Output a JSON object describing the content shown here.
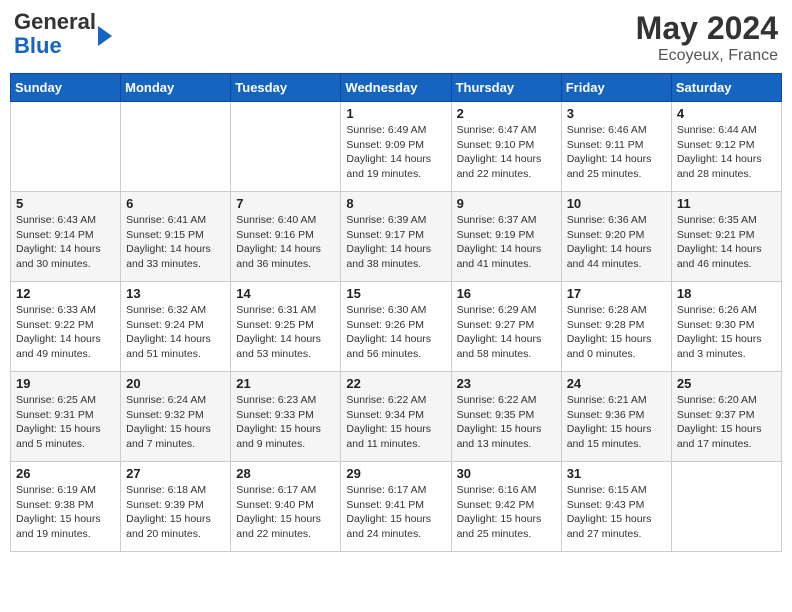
{
  "header": {
    "logo_line1": "General",
    "logo_line2": "Blue",
    "month": "May 2024",
    "location": "Ecoyeux, France"
  },
  "days_of_week": [
    "Sunday",
    "Monday",
    "Tuesday",
    "Wednesday",
    "Thursday",
    "Friday",
    "Saturday"
  ],
  "weeks": [
    [
      {
        "day": "",
        "info": ""
      },
      {
        "day": "",
        "info": ""
      },
      {
        "day": "",
        "info": ""
      },
      {
        "day": "1",
        "info": "Sunrise: 6:49 AM\nSunset: 9:09 PM\nDaylight: 14 hours\nand 19 minutes."
      },
      {
        "day": "2",
        "info": "Sunrise: 6:47 AM\nSunset: 9:10 PM\nDaylight: 14 hours\nand 22 minutes."
      },
      {
        "day": "3",
        "info": "Sunrise: 6:46 AM\nSunset: 9:11 PM\nDaylight: 14 hours\nand 25 minutes."
      },
      {
        "day": "4",
        "info": "Sunrise: 6:44 AM\nSunset: 9:12 PM\nDaylight: 14 hours\nand 28 minutes."
      }
    ],
    [
      {
        "day": "5",
        "info": "Sunrise: 6:43 AM\nSunset: 9:14 PM\nDaylight: 14 hours\nand 30 minutes."
      },
      {
        "day": "6",
        "info": "Sunrise: 6:41 AM\nSunset: 9:15 PM\nDaylight: 14 hours\nand 33 minutes."
      },
      {
        "day": "7",
        "info": "Sunrise: 6:40 AM\nSunset: 9:16 PM\nDaylight: 14 hours\nand 36 minutes."
      },
      {
        "day": "8",
        "info": "Sunrise: 6:39 AM\nSunset: 9:17 PM\nDaylight: 14 hours\nand 38 minutes."
      },
      {
        "day": "9",
        "info": "Sunrise: 6:37 AM\nSunset: 9:19 PM\nDaylight: 14 hours\nand 41 minutes."
      },
      {
        "day": "10",
        "info": "Sunrise: 6:36 AM\nSunset: 9:20 PM\nDaylight: 14 hours\nand 44 minutes."
      },
      {
        "day": "11",
        "info": "Sunrise: 6:35 AM\nSunset: 9:21 PM\nDaylight: 14 hours\nand 46 minutes."
      }
    ],
    [
      {
        "day": "12",
        "info": "Sunrise: 6:33 AM\nSunset: 9:22 PM\nDaylight: 14 hours\nand 49 minutes."
      },
      {
        "day": "13",
        "info": "Sunrise: 6:32 AM\nSunset: 9:24 PM\nDaylight: 14 hours\nand 51 minutes."
      },
      {
        "day": "14",
        "info": "Sunrise: 6:31 AM\nSunset: 9:25 PM\nDaylight: 14 hours\nand 53 minutes."
      },
      {
        "day": "15",
        "info": "Sunrise: 6:30 AM\nSunset: 9:26 PM\nDaylight: 14 hours\nand 56 minutes."
      },
      {
        "day": "16",
        "info": "Sunrise: 6:29 AM\nSunset: 9:27 PM\nDaylight: 14 hours\nand 58 minutes."
      },
      {
        "day": "17",
        "info": "Sunrise: 6:28 AM\nSunset: 9:28 PM\nDaylight: 15 hours\nand 0 minutes."
      },
      {
        "day": "18",
        "info": "Sunrise: 6:26 AM\nSunset: 9:30 PM\nDaylight: 15 hours\nand 3 minutes."
      }
    ],
    [
      {
        "day": "19",
        "info": "Sunrise: 6:25 AM\nSunset: 9:31 PM\nDaylight: 15 hours\nand 5 minutes."
      },
      {
        "day": "20",
        "info": "Sunrise: 6:24 AM\nSunset: 9:32 PM\nDaylight: 15 hours\nand 7 minutes."
      },
      {
        "day": "21",
        "info": "Sunrise: 6:23 AM\nSunset: 9:33 PM\nDaylight: 15 hours\nand 9 minutes."
      },
      {
        "day": "22",
        "info": "Sunrise: 6:22 AM\nSunset: 9:34 PM\nDaylight: 15 hours\nand 11 minutes."
      },
      {
        "day": "23",
        "info": "Sunrise: 6:22 AM\nSunset: 9:35 PM\nDaylight: 15 hours\nand 13 minutes."
      },
      {
        "day": "24",
        "info": "Sunrise: 6:21 AM\nSunset: 9:36 PM\nDaylight: 15 hours\nand 15 minutes."
      },
      {
        "day": "25",
        "info": "Sunrise: 6:20 AM\nSunset: 9:37 PM\nDaylight: 15 hours\nand 17 minutes."
      }
    ],
    [
      {
        "day": "26",
        "info": "Sunrise: 6:19 AM\nSunset: 9:38 PM\nDaylight: 15 hours\nand 19 minutes."
      },
      {
        "day": "27",
        "info": "Sunrise: 6:18 AM\nSunset: 9:39 PM\nDaylight: 15 hours\nand 20 minutes."
      },
      {
        "day": "28",
        "info": "Sunrise: 6:17 AM\nSunset: 9:40 PM\nDaylight: 15 hours\nand 22 minutes."
      },
      {
        "day": "29",
        "info": "Sunrise: 6:17 AM\nSunset: 9:41 PM\nDaylight: 15 hours\nand 24 minutes."
      },
      {
        "day": "30",
        "info": "Sunrise: 6:16 AM\nSunset: 9:42 PM\nDaylight: 15 hours\nand 25 minutes."
      },
      {
        "day": "31",
        "info": "Sunrise: 6:15 AM\nSunset: 9:43 PM\nDaylight: 15 hours\nand 27 minutes."
      },
      {
        "day": "",
        "info": ""
      }
    ]
  ]
}
